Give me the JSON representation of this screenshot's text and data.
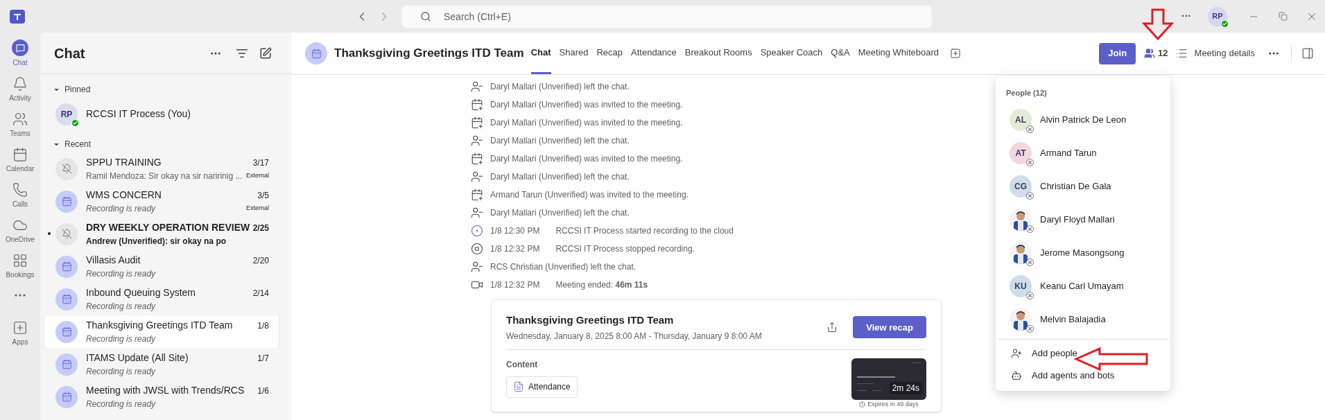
{
  "titlebar": {
    "search": {
      "placeholder": "Search (Ctrl+E)"
    },
    "avatar": "RP",
    "more": "···"
  },
  "rail": [
    {
      "label": "Chat",
      "kind": "chat",
      "selected": true
    },
    {
      "label": "Activity",
      "kind": "bell",
      "selected": false
    },
    {
      "label": "Teams",
      "kind": "teams",
      "selected": false
    },
    {
      "label": "Calendar",
      "kind": "calendar",
      "selected": false
    },
    {
      "label": "Calls",
      "kind": "phone",
      "selected": false
    },
    {
      "label": "OneDrive",
      "kind": "cloud",
      "selected": false
    },
    {
      "label": "Bookings",
      "kind": "bookings",
      "selected": false
    },
    {
      "kind": "more",
      "selected": false
    },
    {
      "label": "Apps",
      "kind": "apps",
      "selected": false
    }
  ],
  "chat_list": {
    "title": "Chat",
    "sections": [
      {
        "title": "Pinned",
        "expanded": true,
        "items": [
          {
            "kind": "person",
            "initials": "RP",
            "name": "RCCSI IT Process (You)",
            "selected": false,
            "unread": false
          }
        ]
      },
      {
        "title": "Recent",
        "expanded": true,
        "items": [
          {
            "kind": "muted",
            "name": "SPPU TRAINING",
            "date": "3/17",
            "preview": "Ramil Mendoza: Sir okay na sir naririnig ...",
            "badge": "External",
            "selected": false,
            "unread": false
          },
          {
            "kind": "meeting",
            "name": "WMS CONCERN",
            "date": "3/5",
            "preview": "Recording is ready",
            "badge": "External",
            "selected": false,
            "unread": false
          },
          {
            "kind": "muted",
            "name": "DRY WEEKLY OPERATION REVIEW",
            "date": "2/25",
            "preview": "Andrew (Unverified): sir okay na po",
            "selected": false,
            "unread": true
          },
          {
            "kind": "meeting",
            "name": "Villasis Audit",
            "date": "2/20",
            "preview": "Recording is ready",
            "selected": false,
            "unread": false
          },
          {
            "kind": "meeting",
            "name": "Inbound Queuing System",
            "date": "2/14",
            "preview": "Recording is ready",
            "selected": false,
            "unread": false
          },
          {
            "kind": "meeting",
            "name": "Thanksgiving Greetings ITD Team",
            "date": "1/8",
            "preview": "Recording is ready",
            "selected": true,
            "unread": false
          },
          {
            "kind": "meeting",
            "name": "ITAMS Update (All Site)",
            "date": "1/7",
            "preview": "Recording is ready",
            "selected": false,
            "unread": false
          },
          {
            "kind": "meeting",
            "name": "Meeting with JWSL with Trends/RCS",
            "date": "1/6",
            "preview": "Recording is ready",
            "selected": false,
            "unread": false
          }
        ]
      }
    ]
  },
  "header": {
    "title": "Thanksgiving Greetings ITD Team",
    "tabs": [
      {
        "label": "Chat",
        "selected": true
      },
      {
        "label": "Shared",
        "selected": false
      },
      {
        "label": "Recap",
        "selected": false
      },
      {
        "label": "Attendance",
        "selected": false
      },
      {
        "label": "Breakout Rooms",
        "selected": false
      },
      {
        "label": "Speaker Coach",
        "selected": false
      },
      {
        "label": "Q&A",
        "selected": false
      },
      {
        "label": "Meeting Whiteboard",
        "selected": false
      }
    ],
    "join": "Join",
    "people_count": "12",
    "details": "Meeting details"
  },
  "messages": [
    {
      "kind": "left",
      "text": "Daryl Mallari (Unverified) left the chat."
    },
    {
      "kind": "invited",
      "text": "Daryl Mallari (Unverified) was invited to the meeting."
    },
    {
      "kind": "invited",
      "text": "Daryl Mallari (Unverified) was invited to the meeting."
    },
    {
      "kind": "left",
      "text": "Daryl Mallari (Unverified) left the chat."
    },
    {
      "kind": "invited",
      "text": "Daryl Mallari (Unverified) was invited to the meeting."
    },
    {
      "kind": "left",
      "text": "Daryl Mallari (Unverified) left the chat."
    },
    {
      "kind": "invited",
      "text": "Armand Tarun (Unverified) was invited to the meeting."
    },
    {
      "kind": "left",
      "text": "Daryl Mallari (Unverified) left the chat."
    },
    {
      "kind": "rec_start",
      "time": "1/8 12:30 PM",
      "text": "RCCSI IT Process started recording to the cloud"
    },
    {
      "kind": "rec_stop",
      "time": "1/8 12:32 PM",
      "text": "RCCSI IT Process stopped recording."
    },
    {
      "kind": "left",
      "text": "RCS Christian (Unverified) left the chat."
    },
    {
      "kind": "ended",
      "time": "1/8 12:32 PM",
      "text": "Meeting ended: **46m 11s**"
    }
  ],
  "recap_card": {
    "title": "Thanksgiving Greetings ITD Team",
    "when": "Wednesday, January 8, 2025 8:00 AM - Thursday, January 9 8:00 AM",
    "button": "View recap",
    "content_label": "Content",
    "attachment": "Attendance",
    "duration": "2m 24s",
    "expires": "Expires in 49 days"
  },
  "people_popup": {
    "title": "People (12)",
    "people": [
      {
        "kind": "initials",
        "initials": "AL",
        "name": "Alvin Patrick De Leon",
        "color": "#e3ecd9"
      },
      {
        "kind": "initials",
        "initials": "AT",
        "name": "Armand Tarun",
        "color": "#f4d6e2"
      },
      {
        "kind": "initials",
        "initials": "CG",
        "name": "Christian De Gala",
        "color": "#cfdcec"
      },
      {
        "name": "Daryl Floyd Mallari"
      },
      {
        "name": "Jerome Masongsong"
      },
      {
        "kind": "initials",
        "initials": "KU",
        "name": "Keanu Carl Umayam",
        "color": "#cfdcec"
      },
      {
        "name": "Melvin Balajadia"
      }
    ],
    "actions": [
      {
        "kind": "people",
        "label": "Add people"
      },
      {
        "kind": "bots",
        "label": "Add agents and bots"
      }
    ]
  }
}
